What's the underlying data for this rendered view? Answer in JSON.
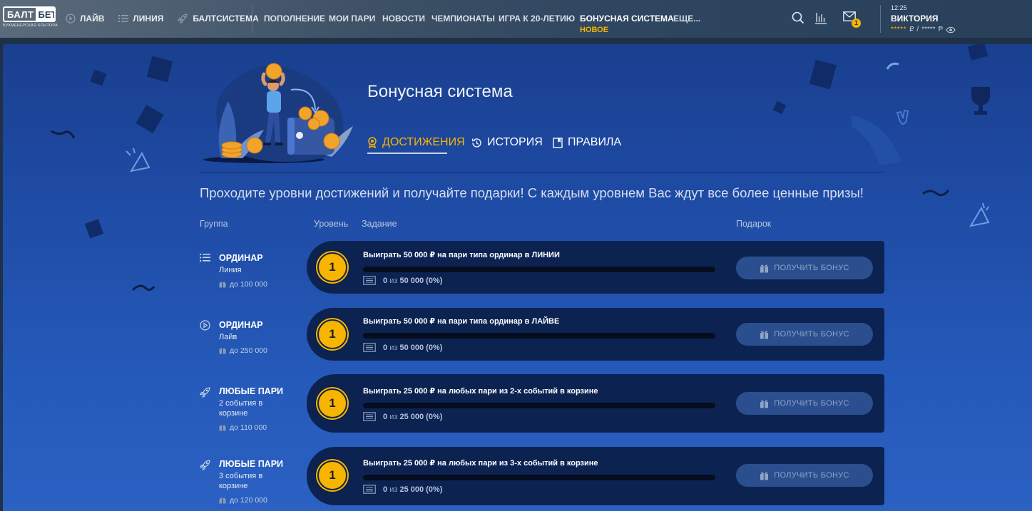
{
  "logo": {
    "main_left": "БАЛТ",
    "main_right": "БЕТ",
    "sub": "БУКМЕКЕРСКАЯ КОНТОРА"
  },
  "nav_main": [
    {
      "label": "ЛАЙВ",
      "icon": "play-circle-icon"
    },
    {
      "label": "ЛИНИЯ",
      "icon": "list-icon"
    },
    {
      "label": "БАЛТСИСТЕМА",
      "icon": "rocket-icon"
    }
  ],
  "nav_secondary": [
    "ПОПОЛНЕНИЕ",
    "МОИ ПАРИ",
    "НОВОСТИ",
    "ЧЕМПИОНАТЫ",
    "ИГРА К 20-ЛЕТИЮ",
    "БОНУСНАЯ СИСТЕМА",
    "ЕЩЕ..."
  ],
  "nav_new_label": "НОВОЕ",
  "notifications_count": "1",
  "user": {
    "time": "12:25",
    "name": "ВИКТОРИЯ",
    "balance_masked": "*****",
    "currency1": "₽",
    "slash": "/",
    "currency2": "Ᵽ"
  },
  "page": {
    "title": "Бонусная система",
    "tabs": [
      "ДОСТИЖЕНИЯ",
      "ИСТОРИЯ",
      "ПРАВИЛА"
    ],
    "lead": "Проходите уровни достижений и получайте подарки! С каждым уровнем Вас ждут все более ценные призы!",
    "columns": {
      "group": "Группа",
      "level": "Уровень",
      "task": "Задание",
      "gift": "Подарок"
    }
  },
  "achievements": [
    {
      "icon": "list-icon",
      "name": "ОРДИНАР",
      "sub": "Линия",
      "prize": "до 100 000",
      "level": "1",
      "task": "Выиграть 50 000 ₽ на пари типа ординар в ЛИНИИ",
      "progress_value": "0",
      "progress_of": "из",
      "progress_total": "50 000 (0%)",
      "progress_fraction": 0,
      "button": "ПОЛУЧИТЬ БОНУС"
    },
    {
      "icon": "play-circle-icon",
      "name": "ОРДИНАР",
      "sub": "Лайв",
      "prize": "до 250 000",
      "level": "1",
      "task": "Выиграть 50 000 ₽ на пари типа ординар в ЛАЙВЕ",
      "progress_value": "0",
      "progress_of": "из",
      "progress_total": "50 000 (0%)",
      "progress_fraction": 0,
      "button": "ПОЛУЧИТЬ БОНУС"
    },
    {
      "icon": "rocket-icon",
      "name": "ЛЮБЫЕ ПАРИ",
      "sub": "2 события в корзине",
      "prize": "до 110 000",
      "level": "1",
      "task": "Выиграть 25 000 ₽ на любых пари из 2-х событий в корзине",
      "progress_value": "0",
      "progress_of": "из",
      "progress_total": "25 000 (0%)",
      "progress_fraction": 0,
      "button": "ПОЛУЧИТЬ БОНУС"
    },
    {
      "icon": "rocket-icon",
      "name": "ЛЮБЫЕ ПАРИ",
      "sub": "3 события в корзине",
      "prize": "до 120 000",
      "level": "1",
      "task": "Выиграть 25 000 ₽ на любых пари из 3-х событий в корзине",
      "progress_value": "0",
      "progress_of": "из",
      "progress_total": "25 000 (0%)",
      "progress_fraction": 0,
      "button": "ПОЛУЧИТЬ БОНУС"
    }
  ],
  "colors": {
    "accent": "#f7b500",
    "panel": "#1e4aa3",
    "card": "#0c2352",
    "button": "#2b4f8e"
  }
}
